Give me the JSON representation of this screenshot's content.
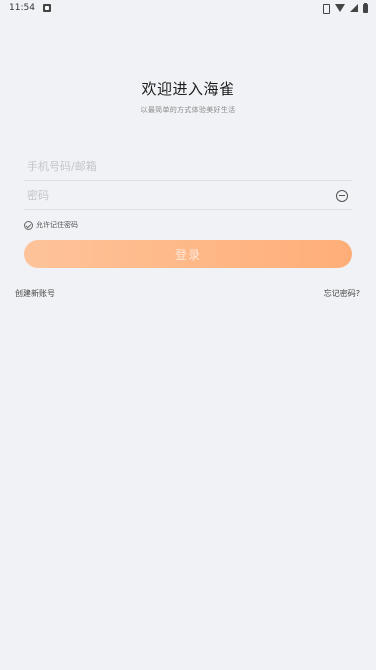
{
  "status_bar": {
    "time": "11:54",
    "icons": [
      "notification-icon",
      "vibrate-icon",
      "wifi-icon",
      "signal-icon",
      "battery-icon"
    ]
  },
  "header": {
    "title": "欢迎进入海雀",
    "subtitle": "以最简单的方式体验美好生活"
  },
  "form": {
    "account_placeholder": "手机号码/邮箱",
    "account_value": "",
    "password_placeholder": "密码",
    "password_value": "",
    "password_toggle_icon": "eye-closed-icon",
    "remember_label": "允许记住密码",
    "remember_checked": true,
    "login_label": "登录",
    "login_enabled": false
  },
  "links": {
    "create_account": "创建新账号",
    "forgot_password": "忘记密码?"
  },
  "colors": {
    "background": "#f1f2f6",
    "button_gradient_start": "#fec399",
    "button_gradient_end": "#ffae78"
  }
}
